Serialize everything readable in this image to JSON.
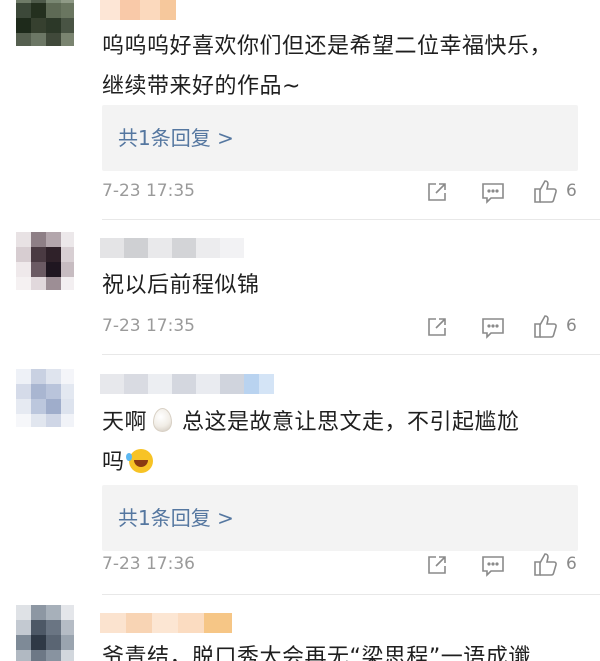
{
  "comments": [
    {
      "text": "呜呜呜好喜欢你们但还是希望二位幸福快乐，继续带来好的作品~",
      "reply_label": "共1条回复 >",
      "time": "7-23 17:35",
      "likes": "6"
    },
    {
      "text": "祝以后前程似锦",
      "time": "7-23 17:35",
      "likes": "6"
    },
    {
      "text_before_emoji": "天啊",
      "text_after_emoji": "总这是故意让思文走，不引起尴尬",
      "text_line2": "吗",
      "reply_label": "共1条回复 >",
      "time": "7-23 17:36",
      "likes": "6"
    },
    {
      "text": "爷青结，脱口秀大会再无“梁思程”一语成谶"
    }
  ],
  "icons": [
    "share-icon",
    "comment-icon",
    "like-icon"
  ],
  "colors": {
    "link": "#5577a0",
    "meta": "#9a9a9a",
    "reply_bg": "#f3f3f3"
  }
}
